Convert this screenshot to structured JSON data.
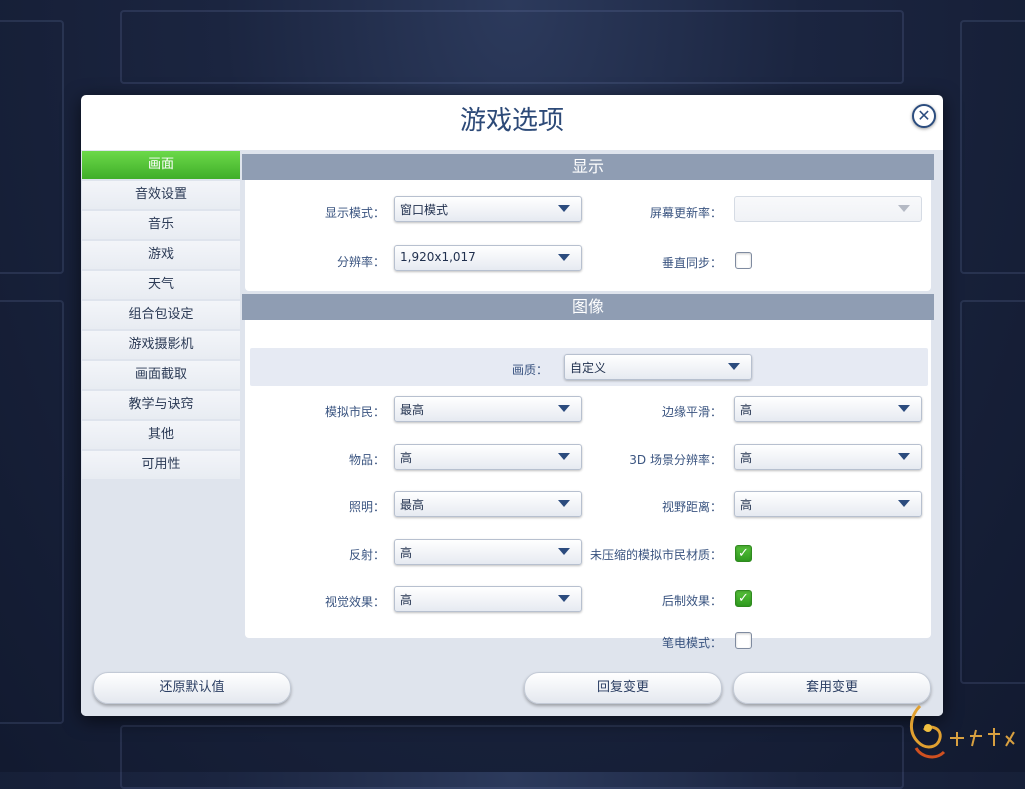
{
  "dialog": {
    "title": "游戏选项",
    "close_icon": "close-icon"
  },
  "sidebar": {
    "items": [
      {
        "label": "画面",
        "active": true
      },
      {
        "label": "音效设置"
      },
      {
        "label": "音乐"
      },
      {
        "label": "游戏"
      },
      {
        "label": "天气"
      },
      {
        "label": "组合包设定"
      },
      {
        "label": "游戏摄影机"
      },
      {
        "label": "画面截取"
      },
      {
        "label": "教学与诀窍"
      },
      {
        "label": "其他"
      },
      {
        "label": "可用性"
      }
    ]
  },
  "display": {
    "header": "显示",
    "display_mode_label": "显示模式：",
    "display_mode_value": "窗口模式",
    "resolution_label": "分辨率：",
    "resolution_value": "1,920x1,017",
    "refresh_rate_label": "屏幕更新率：",
    "refresh_rate_value": "",
    "vsync_label": "垂直同步：",
    "vsync_checked": false
  },
  "graphics": {
    "header": "图像",
    "quality_label": "画质：",
    "quality_value": "自定义",
    "sims_label": "模拟市民：",
    "sims_value": "最高",
    "objects_label": "物品：",
    "objects_value": "高",
    "lighting_label": "照明：",
    "lighting_value": "最高",
    "reflections_label": "反射：",
    "reflections_value": "高",
    "visual_effects_label": "视觉效果：",
    "visual_effects_value": "高",
    "edge_smoothing_label": "边缘平滑：",
    "edge_smoothing_value": "高",
    "scene_res_label": "3D 场景分辨率：",
    "scene_res_value": "高",
    "view_distance_label": "视野距离：",
    "view_distance_value": "高",
    "uncompressed_label": "未压缩的模拟市民材质：",
    "uncompressed_checked": true,
    "postfx_label": "后制效果：",
    "postfx_checked": true,
    "laptop_label": "笔电模式：",
    "laptop_checked": false
  },
  "footer": {
    "restore_defaults": "还原默认值",
    "revert_changes": "回复变更",
    "apply_changes": "套用变更"
  },
  "colors": {
    "accent_green": "#4cc233",
    "title_blue": "#2d4a78",
    "section_header": "#8f9db3"
  }
}
